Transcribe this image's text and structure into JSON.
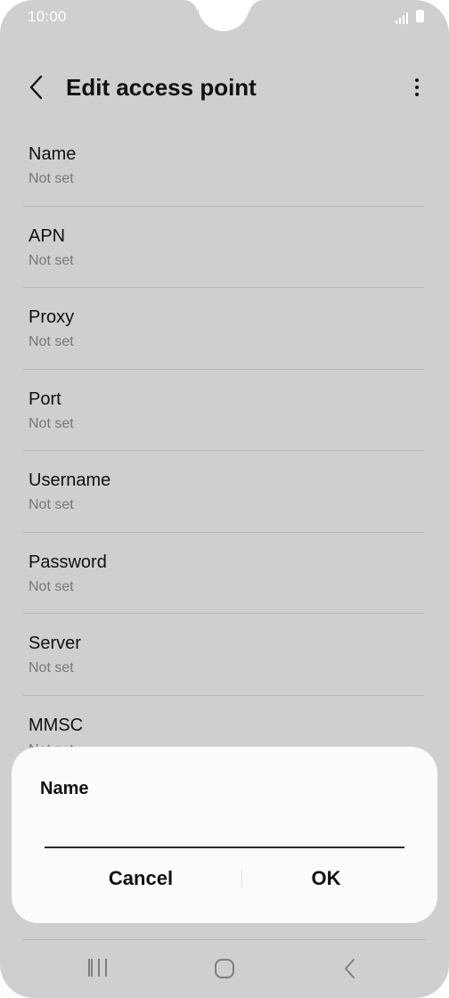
{
  "status_bar": {
    "time": "10:00",
    "icons": [
      "signal-icon",
      "battery-icon"
    ]
  },
  "app_bar": {
    "title": "Edit access point",
    "back_icon": "chevron-left-icon",
    "more_icon": "more-vertical-icon"
  },
  "settings": {
    "items": [
      {
        "title": "Name",
        "value": "Not set"
      },
      {
        "title": "APN",
        "value": "Not set"
      },
      {
        "title": "Proxy",
        "value": "Not set"
      },
      {
        "title": "Port",
        "value": "Not set"
      },
      {
        "title": "Username",
        "value": "Not set"
      },
      {
        "title": "Password",
        "value": "Not set"
      },
      {
        "title": "Server",
        "value": "Not set"
      },
      {
        "title": "MMSC",
        "value": "Not set"
      }
    ]
  },
  "dialog": {
    "title": "Name",
    "input_value": "",
    "cancel_label": "Cancel",
    "ok_label": "OK"
  },
  "nav_bar": {
    "icons": [
      "recents-icon",
      "home-icon",
      "back-icon"
    ]
  },
  "colors": {
    "background_dim": "#cfcfd2",
    "dialog_bg": "#fbfbfd",
    "text_primary": "#111111",
    "text_secondary": "#77777a"
  }
}
